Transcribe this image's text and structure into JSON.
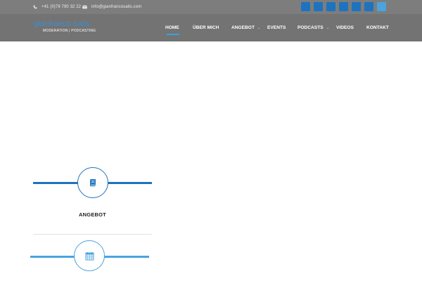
{
  "topbar": {
    "phone": "+41 (0)79 790 32 22",
    "email": "info@gianfrancosalis.com",
    "phone_icon": "phone-icon",
    "email_icon": "envelope-icon",
    "social_icons": [
      "social-icon-1",
      "social-icon-2",
      "social-icon-3",
      "social-icon-4",
      "social-icon-5",
      "social-icon-6",
      "social-icon-7"
    ]
  },
  "logo": {
    "name": "gianfranco salis",
    "tagline": "MODERATION | PODCASTING"
  },
  "nav": {
    "items": [
      {
        "label": "HOME",
        "active": true
      },
      {
        "label": "ÜBER MICH"
      },
      {
        "label": "ANGEBOT",
        "has_dropdown": true
      },
      {
        "label": "EVENTS"
      },
      {
        "label": "PODCASTS",
        "has_dropdown": true
      },
      {
        "label": "VIDEOS"
      },
      {
        "label": "KONTAKT"
      }
    ],
    "dropdown_glyph": "⌄"
  },
  "features": [
    {
      "title": "ANGEBOT",
      "icon": "book-icon"
    },
    {
      "title": "",
      "icon": "calendar-icon"
    }
  ],
  "colors": {
    "header": "#737373",
    "brand_blue": "#1e73be",
    "light_blue": "#4aa3df",
    "nav_active": "#3aa1df"
  }
}
